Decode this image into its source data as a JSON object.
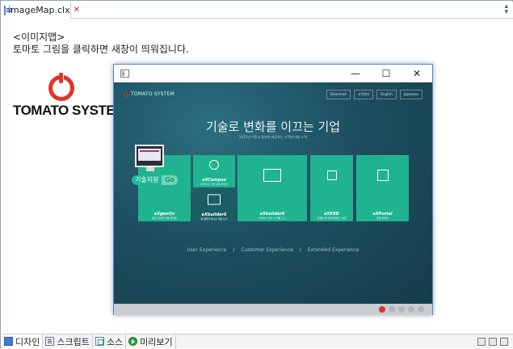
{
  "editor": {
    "tab_label": "imageMap.clx",
    "tab_close": "✕"
  },
  "canvas": {
    "description_line1": "<이미지맵>",
    "description_line2": "토마토 그림을 클릭하면 새창이 띄워집니다.",
    "logo_text": "TOMATO SYSTEM"
  },
  "popup": {
    "controls": [
      "—",
      "☐",
      "✕"
    ],
    "site": {
      "brand": "TOMATO SYSTEM",
      "nav_links": [
        "Download",
        "고객센터",
        "English",
        "Japanese"
      ],
      "hero_title": "기술로 변화를 이끄는 기업",
      "hero_subtitle": "2015년 이루고 끝까지 제공하는 고객에 대한 노력",
      "support_label": "기술지원",
      "support_go": "Go",
      "tiles": [
        {
          "title": "eXgenOn",
          "sub": "통합 모바일 개발 플랫폼"
        },
        {
          "title": "eXCampus",
          "sub": "클라우드 기반 교육 솔루션"
        },
        {
          "title": "eXbuilder6",
          "sub": "웹 애플리케이션 개발 도구"
        },
        {
          "title": "eXbuilder6",
          "sub": "HTML5 기반 UI 개발 도구"
        },
        {
          "title": "eXERD",
          "sub": "모델링 및 데이터베이스 설계"
        },
        {
          "title": "eXPortal",
          "sub": "포털 솔루션"
        }
      ],
      "bottom_tags": [
        "User Experience",
        "/",
        "Customer Experience",
        "/",
        "Extended Experience"
      ]
    }
  },
  "bottom_tabs": [
    {
      "label": "디자인",
      "icon": "design-icon"
    },
    {
      "label": "스크립트",
      "icon": "script-icon"
    },
    {
      "label": "소스",
      "icon": "source-icon"
    },
    {
      "label": "미리보기",
      "icon": "preview-icon"
    }
  ],
  "colors": {
    "brand_red": "#e0322b",
    "tile_green": "#20b38f",
    "site_bg": "#1d4f61",
    "popup_border": "#4a8bd6"
  }
}
